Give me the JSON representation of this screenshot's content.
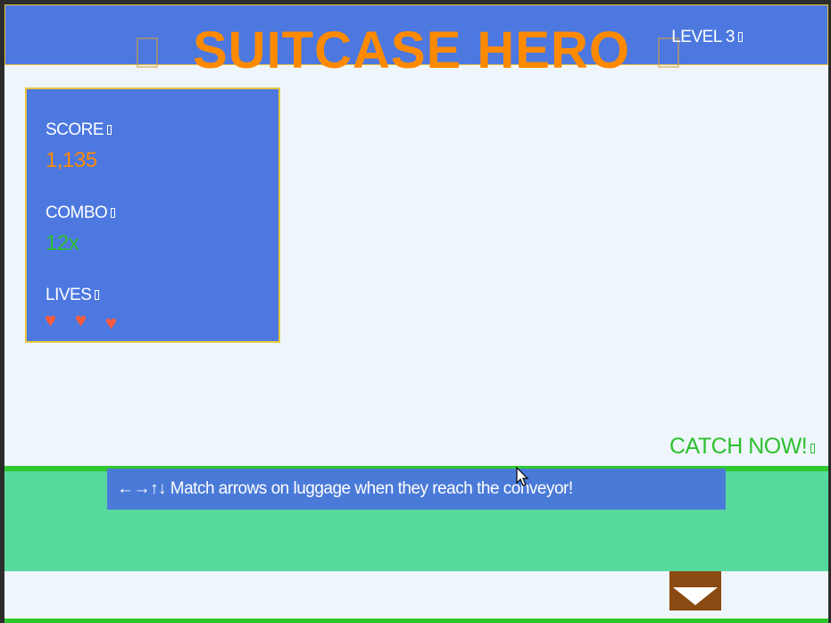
{
  "header": {
    "title": "SUITCASE HERO",
    "level": "LEVEL 3"
  },
  "stats": {
    "score_label": "SCORE",
    "score_value": "1,135",
    "combo_label": "COMBO",
    "combo_value": "12x",
    "lives_label": "LIVES",
    "lives": 3,
    "heart_glyph": "♥"
  },
  "prompt": "CATCH NOW!",
  "instructions": "←→↑↓ Match arrows on luggage when they reach the conveyor!",
  "colors": {
    "header_bg": "#4c78e0",
    "title": "#ff8a00",
    "score": "#ff8a00",
    "combo": "#2ec02e",
    "heart": "#ff5a3a",
    "conveyor": "#57d99d",
    "button": "#8a4a12"
  },
  "icons": {
    "drop_button": "chevron-down-icon",
    "cursor": "mouse-pointer-icon"
  }
}
